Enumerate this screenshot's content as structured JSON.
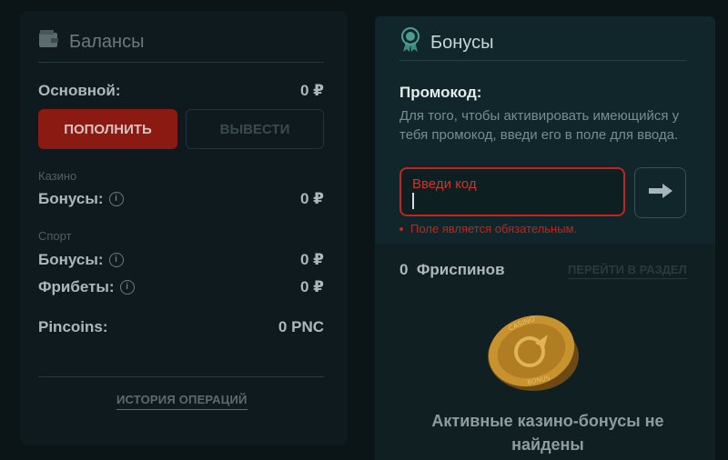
{
  "balances": {
    "title": "Балансы",
    "main_label": "Основной:",
    "main_value": "0 ₽",
    "deposit_label": "ПОПОЛНИТЬ",
    "withdraw_label": "ВЫВЕСТИ",
    "casino_section": "Казино",
    "casino_bonus_label": "Бонусы:",
    "casino_bonus_value": "0 ₽",
    "sport_section": "Спорт",
    "sport_bonus_label": "Бонусы:",
    "sport_bonus_value": "0 ₽",
    "freebets_label": "Фрибеты:",
    "freebets_value": "0 ₽",
    "pincoins_label": "Pincoins:",
    "pincoins_value": "0 PNC",
    "history_link": "ИСТОРИЯ ОПЕРАЦИЙ",
    "info_icon_glyph": "i"
  },
  "bonuses": {
    "title": "Бонусы",
    "promo_label": "Промокод:",
    "promo_desc": "Для того, чтобы активировать имеющийся у тебя промокод, введи его в поле для ввода.",
    "promo_placeholder": "Введи код",
    "promo_error": "Поле является обязательным."
  },
  "freespins": {
    "count_label": "0  Фриспинов",
    "goto_link": "ПЕРЕЙТИ В РАЗДЕЛ",
    "empty_message": "Активные казино-бонусы не найдены",
    "coin_top_text": "CASINO",
    "coin_bottom_text": "BONUS"
  },
  "colors": {
    "accent_red": "#c4241b",
    "deposit_bg": "#8a1a12",
    "coin_gold": "#c8922e"
  }
}
